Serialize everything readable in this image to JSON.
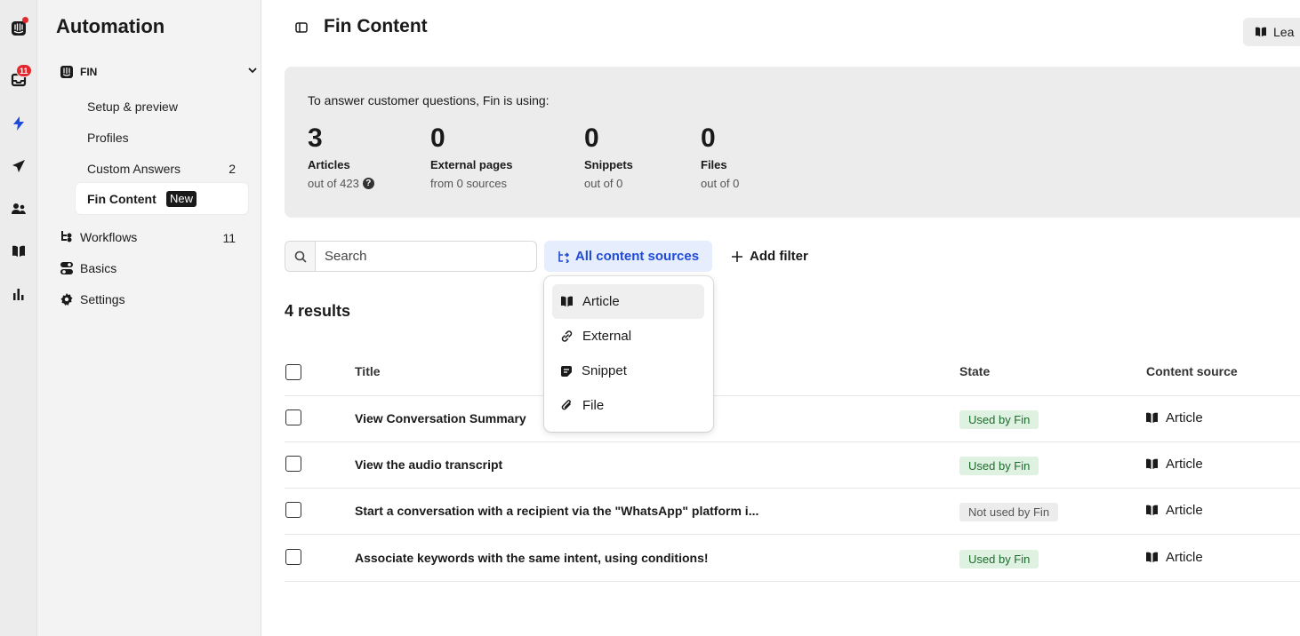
{
  "rail": {
    "items": [
      {
        "icon": "intercom-logo-icon"
      },
      {
        "icon": "inbox-icon",
        "badge": "11"
      },
      {
        "icon": "lightning-icon"
      },
      {
        "icon": "send-icon"
      },
      {
        "icon": "contacts-icon"
      },
      {
        "icon": "book-icon"
      },
      {
        "icon": "reports-icon"
      }
    ]
  },
  "sidebar": {
    "title": "Automation",
    "section_label": "FIN",
    "fin_items": [
      {
        "label": "Setup & preview"
      },
      {
        "label": "Profiles"
      },
      {
        "label": "Custom Answers",
        "count": "2"
      }
    ],
    "active_item": {
      "label": "Fin Content",
      "tag": "New"
    },
    "top_items": [
      {
        "label": "Workflows",
        "count": "11"
      },
      {
        "label": "Basics"
      },
      {
        "label": "Settings"
      }
    ]
  },
  "header": {
    "title": "Fin Content",
    "learn_label": "Lea"
  },
  "stats": {
    "intro": "To answer customer questions, Fin is using:",
    "items": [
      {
        "value": "3",
        "label": "Articles",
        "sub": "out of 423"
      },
      {
        "value": "0",
        "label": "External pages",
        "sub": "from 0 sources"
      },
      {
        "value": "0",
        "label": "Snippets",
        "sub": "out of 0"
      },
      {
        "value": "0",
        "label": "Files",
        "sub": "out of 0"
      }
    ]
  },
  "toolbar": {
    "search_placeholder": "Search",
    "sources_label": "All content sources",
    "add_filter_label": "Add filter"
  },
  "results_label": "4 results",
  "table": {
    "columns": {
      "title": "Title",
      "state": "State",
      "source": "Content source"
    },
    "rows": [
      {
        "title": "View Conversation Summary",
        "state": "Used by Fin",
        "source": "Article"
      },
      {
        "title": "View the audio transcript",
        "state": "Used by Fin",
        "source": "Article"
      },
      {
        "title": "Start a conversation with a recipient via the \"WhatsApp\" platform i...",
        "state": "Not used by Fin",
        "source": "Article"
      },
      {
        "title": "Associate keywords with the same intent, using conditions!",
        "state": "Used by Fin",
        "source": "Article"
      }
    ]
  },
  "dropdown": {
    "items": [
      {
        "label": "Article",
        "icon": "book-icon"
      },
      {
        "label": "External",
        "icon": "link-icon"
      },
      {
        "label": "Snippet",
        "icon": "snippet-icon"
      },
      {
        "label": "File",
        "icon": "paperclip-icon"
      }
    ]
  },
  "colors": {
    "accent": "#1f4bd8",
    "used_bg": "#dff1e1",
    "used_fg": "#1e6b2e",
    "notused_bg": "#ececec",
    "badge": "#e0282e"
  }
}
